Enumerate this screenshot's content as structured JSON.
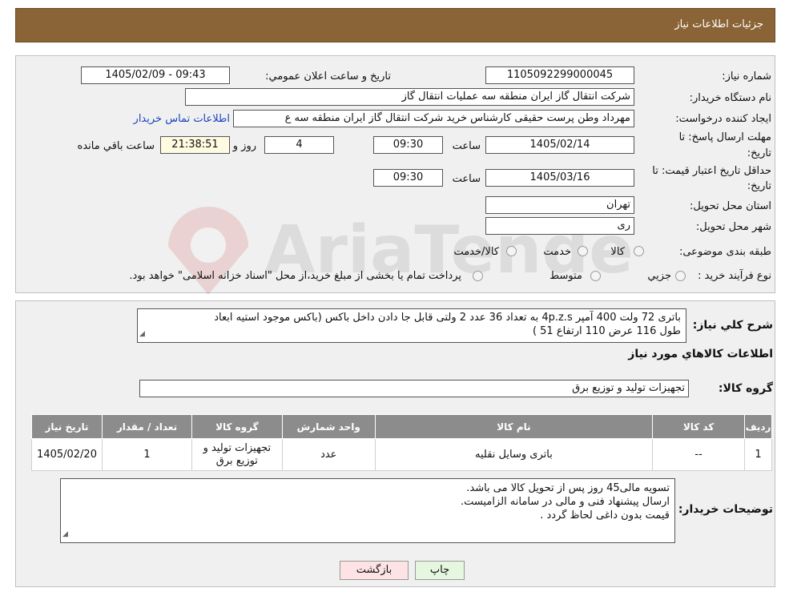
{
  "header": {
    "title": "جزئیات اطلاعات نیاز"
  },
  "form": {
    "need_number_label": "شماره نیاز:",
    "need_number": "1105092299000045",
    "announce_label": "تاریخ و ساعت اعلان عمومي:",
    "announce_value": "1405/02/09 - 09:43",
    "buyer_label": "نام دستگاه خریدار:",
    "buyer_value": "شرکت انتقال گاز ایران منطقه سه عملیات انتقال گاز",
    "creator_label": "ایجاد کننده درخواست:",
    "creator_value": "مهرداد وطن پرست حقیقی کارشناس خرید شرکت انتقال گاز ایران منطقه سه ع",
    "contact_link": "اطلاعات تماس خریدار",
    "deadline_label_1": "مهلت ارسال پاسخ: تا",
    "deadline_label_2": "تاریخ:",
    "deadline_date": "1405/02/14",
    "time_label": "ساعت",
    "deadline_time": "09:30",
    "days_value": "4",
    "days_label": "روز و",
    "remaining_time": "21:38:51",
    "remaining_label": "ساعت باقي مانده",
    "validity_label_1": "حداقل تاریخ اعتبار قیمت: تا",
    "validity_label_2": "تاریخ:",
    "validity_date": "1405/03/16",
    "validity_time": "09:30",
    "province_label": "استان محل تحویل:",
    "province_value": "تهران",
    "city_label": "شهر محل تحویل:",
    "city_value": "ری",
    "category_label": "طبقه بندی موضوعی:",
    "category_options": [
      "کالا",
      "خدمت",
      "کالا/خدمت"
    ],
    "process_label": "نوع فرآیند خرید :",
    "process_options": [
      "جزیي",
      "متوسط"
    ],
    "process_note": "پرداخت تمام یا بخشی از مبلغ خرید،از محل \"اسناد خزانه اسلامی\" خواهد بود."
  },
  "details": {
    "description_label": "شرح کلي نیاز:",
    "description_line1": "باتری 72 ولت 400 آمپر 4p.z.s به تعداد 36 عدد 2 ولتی قابل جا دادن داخل باکس (باکس موجود استیه ابعاد",
    "description_line2": "طول 116 عرض 110 ارتفاع 51 )",
    "goods_info_title": "اطلاعات کالاهاي مورد نیاز",
    "goods_group_label": "گروه کالا:",
    "goods_group_value": "تجهیزات تولید و توزیع برق"
  },
  "table": {
    "headers": [
      "ردیف",
      "کد کالا",
      "نام کالا",
      "واحد شمارش",
      "گروه کالا",
      "تعداد / مقدار",
      "تاریخ نیاز"
    ],
    "rows": [
      {
        "row": "1",
        "code": "--",
        "name": "باتری وسایل نقلیه",
        "unit": "عدد",
        "group": "تجهیزات تولید و توزیع برق",
        "qty": "1",
        "date": "1405/02/20"
      }
    ]
  },
  "notes": {
    "label": "توضیحات خریدار:",
    "line1": "تسویه مالی45 روز پس از تحویل کالا می باشد.",
    "line2": "ارسال پیشنهاد فنی و مالی در سامانه الزامیست.",
    "line3": "قیمت بدون داغی لحاظ گردد ."
  },
  "buttons": {
    "back": "بازگشت",
    "print": "چاپ"
  },
  "watermark": {
    "text": "AriaTender.neT"
  },
  "colors": {
    "header_bg": "#8a6336",
    "table_header_bg": "#8c8c8c",
    "link": "#1a44c2",
    "back_btn": "#fde3e3",
    "print_btn": "#e5f7df"
  }
}
